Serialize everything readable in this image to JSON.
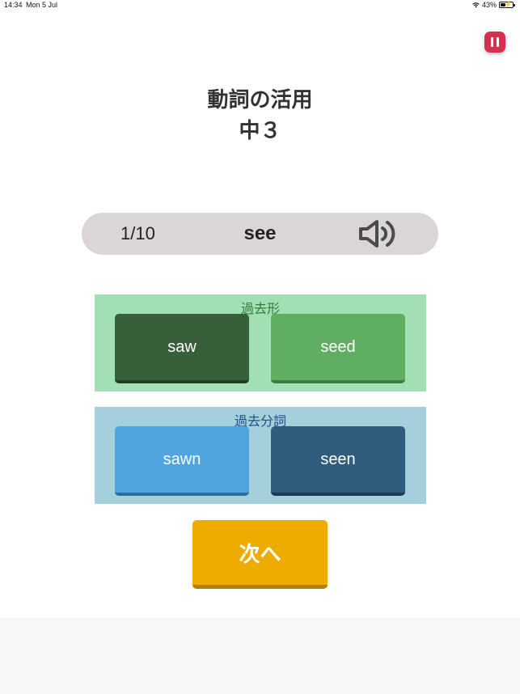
{
  "status_bar": {
    "time": "14:34",
    "date": "Mon 5 Jul",
    "battery": "43%",
    "battery_level": 0.43
  },
  "header": {
    "title": "動詞の活用",
    "grade": "中３"
  },
  "question": {
    "progress": "1/10",
    "verb": "see",
    "sound_icon": "speaker-icon"
  },
  "past_tense": {
    "label": "過去形",
    "options": [
      "saw",
      "seed"
    ]
  },
  "past_participle": {
    "label": "過去分詞",
    "options": [
      "sawn",
      "seen"
    ]
  },
  "next_button": "次へ",
  "colors": {
    "pause": "#d7304f",
    "past_panel": "#a3dfb5",
    "pp_panel": "#a4d0dc",
    "next": "#eeab00"
  }
}
